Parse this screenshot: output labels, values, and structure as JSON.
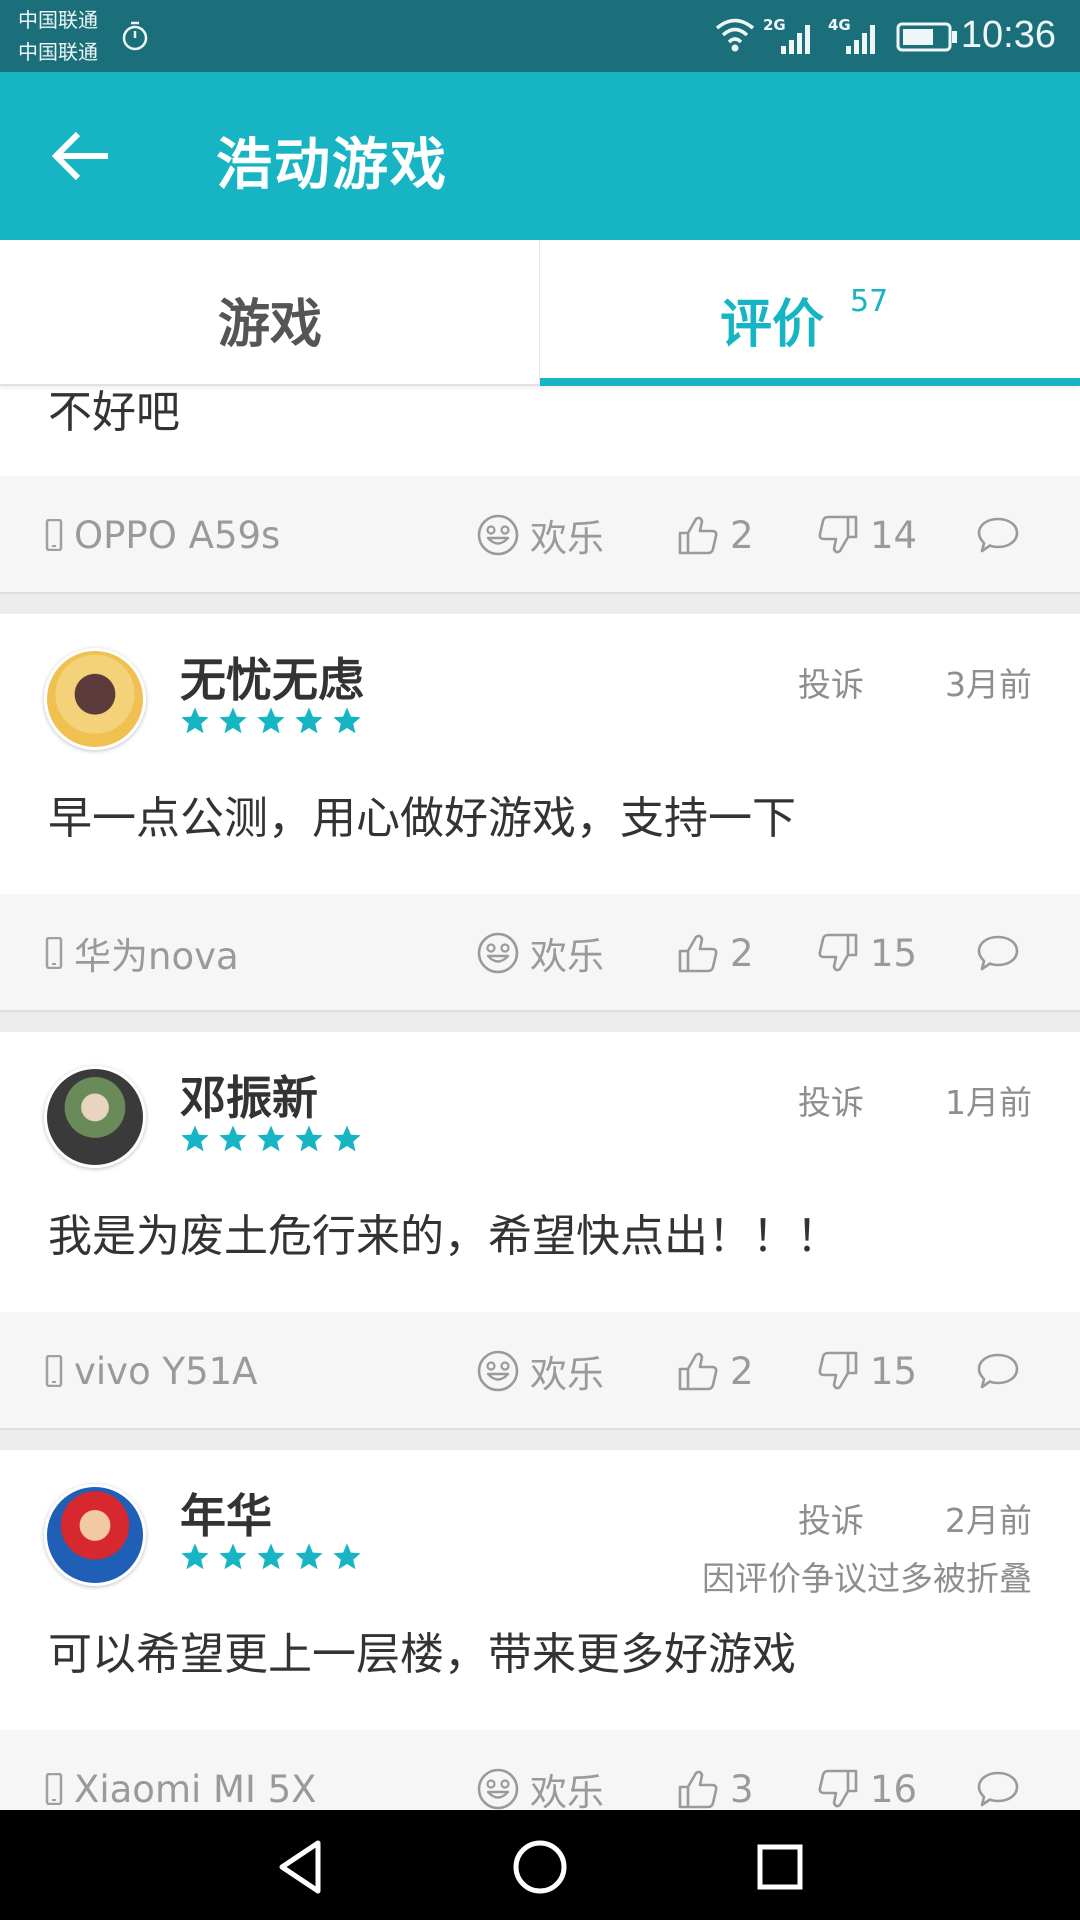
{
  "status_bar": {
    "carrier_1": "中国联通",
    "carrier_2": "中国联通",
    "network_1": "2G",
    "network_2": "4G",
    "time": "10:36",
    "icons": [
      "alarm-icon",
      "wifi-icon",
      "signal-icon",
      "battery-icon"
    ]
  },
  "app_bar": {
    "title": "浩动游戏",
    "back_icon": "arrow-left-icon"
  },
  "tabs": [
    {
      "label": "游戏",
      "active": false
    },
    {
      "label": "评价",
      "badge": "57",
      "active": true
    }
  ],
  "colors": {
    "accent": "#17b4c3",
    "status_bar": "#1b6f7a",
    "star": "#17b4c3"
  },
  "reviews": [
    {
      "text": "不好吧",
      "device": "OPPO A59s",
      "mood": "欢乐",
      "likes": "2",
      "dislikes": "14"
    },
    {
      "user": "无忧无虑",
      "rating": 5,
      "report": "投诉",
      "time": "3月前",
      "text": "早一点公测，用心做好游戏，支持一下",
      "device": "华为nova",
      "mood": "欢乐",
      "likes": "2",
      "dislikes": "15"
    },
    {
      "user": "邓振新",
      "rating": 5,
      "report": "投诉",
      "time": "1月前",
      "text": "我是为废土危行来的，希望快点出！！！",
      "device": "vivo Y51A",
      "mood": "欢乐",
      "likes": "2",
      "dislikes": "15"
    },
    {
      "user": "年华",
      "rating": 5,
      "report": "投诉",
      "time": "2月前",
      "folded_note": "因评价争议过多被折叠",
      "text": "可以希望更上一层楼，带来更多好游戏",
      "device": "Xiaomi MI 5X",
      "mood": "欢乐",
      "likes": "3",
      "dislikes": "16"
    }
  ],
  "nav_bar": [
    "back-triangle-icon",
    "home-circle-icon",
    "recents-square-icon"
  ]
}
